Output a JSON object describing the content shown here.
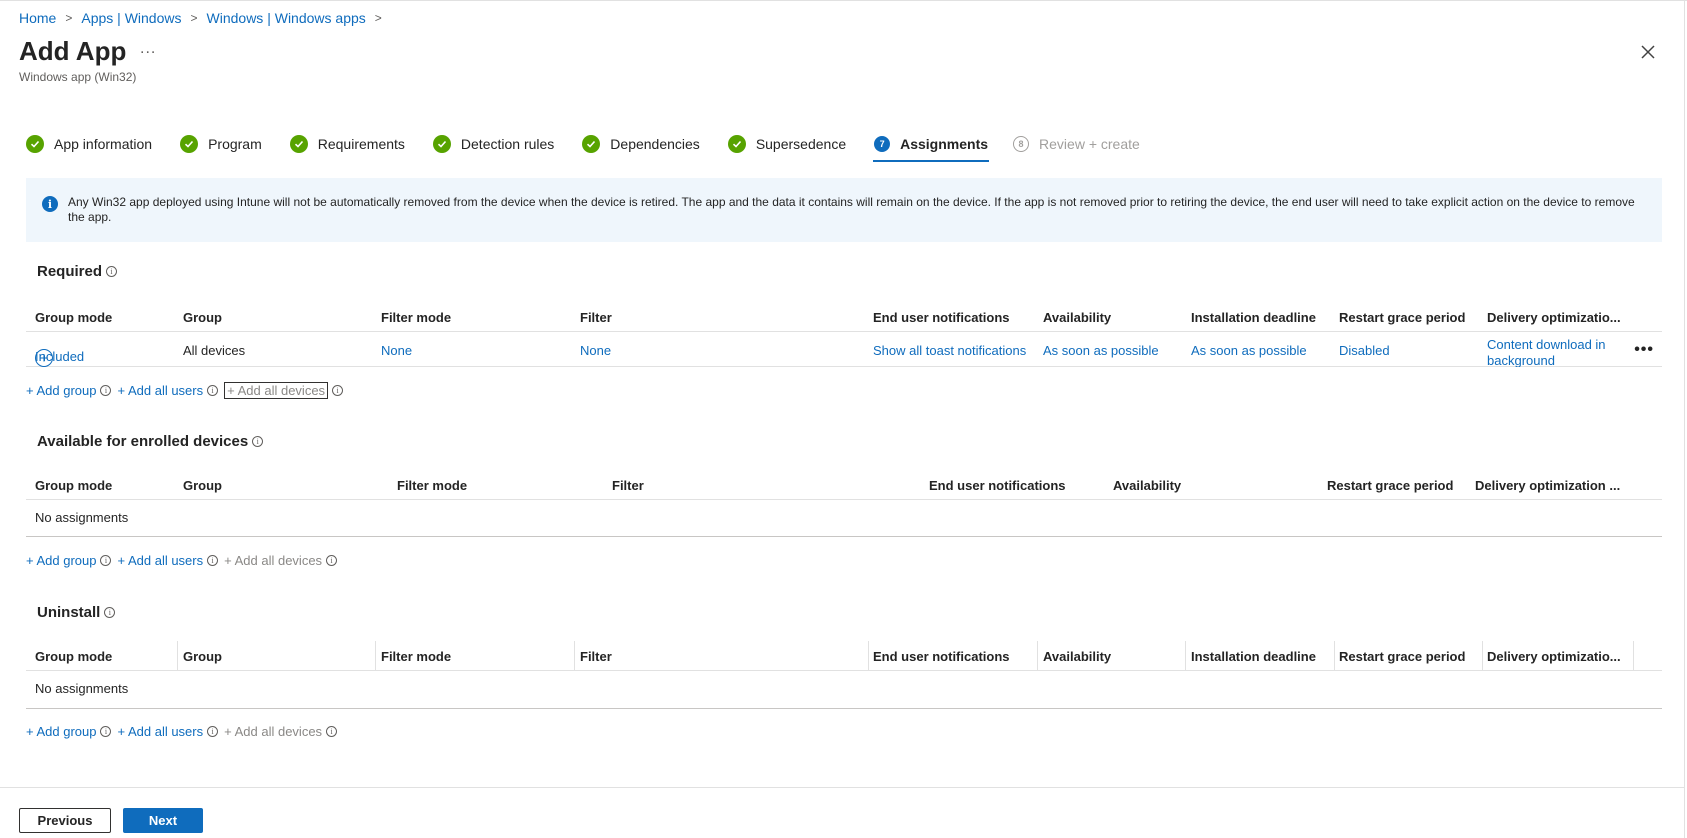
{
  "breadcrumb": {
    "home": "Home",
    "apps_windows": "Apps | Windows",
    "windows_apps": "Windows | Windows apps"
  },
  "header": {
    "title": "Add App",
    "more": "...",
    "subtitle": "Windows app (Win32)"
  },
  "steps": [
    {
      "label": "App information"
    },
    {
      "label": "Program"
    },
    {
      "label": "Requirements"
    },
    {
      "label": "Detection rules"
    },
    {
      "label": "Dependencies"
    },
    {
      "label": "Supersedence"
    },
    {
      "number": "7",
      "label": "Assignments"
    },
    {
      "number": "8",
      "label": "Review + create"
    }
  ],
  "banner": {
    "text": "Any Win32 app deployed using Intune will not be automatically removed from the device when the device is retired. The app and the data it contains will remain on the device. If the app is not removed prior to retiring the device, the end user will need to take explicit action on the device to remove the app."
  },
  "required": {
    "title": "Required",
    "columns": [
      "Group mode",
      "Group",
      "Filter mode",
      "Filter",
      "End user notifications",
      "Availability",
      "Installation deadline",
      "Restart grace period",
      "Delivery optimizatio..."
    ],
    "row": {
      "group_mode": "Included",
      "group": "All devices",
      "filter_mode": "None",
      "filter": "None",
      "notifications": "Show all toast notifications",
      "availability": "As soon as possible",
      "deadline": "As soon as possible",
      "restart": "Disabled",
      "delivery_line1": "Content download in",
      "delivery_line2": "background"
    }
  },
  "available": {
    "title": "Available for enrolled devices",
    "columns": [
      "Group mode",
      "Group",
      "Filter mode",
      "Filter",
      "End user notifications",
      "Availability",
      "Restart grace period",
      "Delivery optimization ..."
    ],
    "empty": "No assignments"
  },
  "uninstall": {
    "title": "Uninstall",
    "columns": [
      "Group mode",
      "Group",
      "Filter mode",
      "Filter",
      "End user notifications",
      "Availability",
      "Installation deadline",
      "Restart grace period",
      "Delivery optimizatio..."
    ],
    "empty": "No assignments"
  },
  "actions": {
    "add_group": "+ Add group",
    "add_all_users": "+ Add all users",
    "add_all_devices": "+ Add all devices"
  },
  "footer": {
    "previous": "Previous",
    "next": "Next"
  },
  "colors": {
    "accent": "#0f6cbd",
    "success": "#57a300",
    "banner_bg": "#eff6fc"
  }
}
